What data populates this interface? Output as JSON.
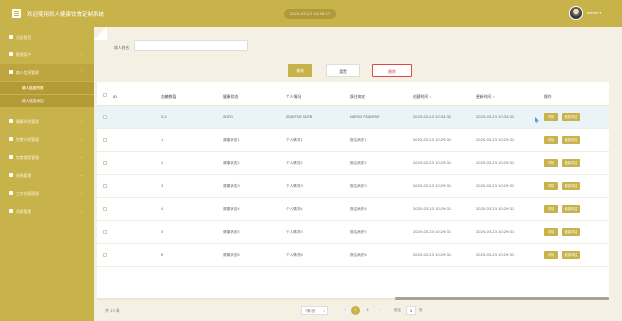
{
  "header": {
    "title": "欢迎使用凯人健康饮食定制系统",
    "datetime": "2025-03-23 10:36:17",
    "user": "admin"
  },
  "sidebar": {
    "items": [
      {
        "label": "功员首页",
        "icon": "home-icon",
        "expandable": false
      },
      {
        "label": "影视用户",
        "icon": "user-icon",
        "expandable": true
      },
      {
        "label": "病人信息管理",
        "icon": "grid-icon",
        "expandable": true,
        "active": true
      },
      {
        "label": "健康评估管理",
        "icon": "grid-icon",
        "expandable": true
      },
      {
        "label": "饮食分类管理",
        "icon": "grid-icon",
        "expandable": true
      },
      {
        "label": "饮食搜索管理",
        "icon": "grid-icon",
        "expandable": true
      },
      {
        "label": "系统管理",
        "icon": "gear-icon",
        "expandable": true
      },
      {
        "label": "工作台管理理",
        "icon": "grid-icon",
        "expandable": true
      },
      {
        "label": "消息管理",
        "icon": "gear-icon",
        "expandable": true
      }
    ],
    "subitems": [
      {
        "label": "病人信息列表",
        "current": true
      },
      {
        "label": "病人信息添加",
        "current": false
      }
    ]
  },
  "search": {
    "label": "病人姓名",
    "value": "",
    "placeholder": ""
  },
  "toolbar": {
    "search_label": "查询",
    "reset_label": "重置",
    "delete_label": "删除"
  },
  "table": {
    "columns": [
      "ID",
      "血糖数值",
      "健康状态",
      "个人情况",
      "既往病史",
      "创建时间",
      "更新时间",
      "操作"
    ],
    "rows": [
      {
        "id": "",
        "sugar": "5.2",
        "status": "SDFD",
        "personal": "SDJKFSD SDFB",
        "history": "NKFSD FSDNFKE",
        "created": "2025-03-23 10:34:32",
        "updated": "2025-03-23 10:34:32"
      },
      {
        "id": "",
        "sugar": "1",
        "status": "健康状态1",
        "personal": "个人情况1",
        "history": "既往病史1",
        "created": "2025-03-23 10:29:31",
        "updated": "2025-03-23 10:29:31"
      },
      {
        "id": "",
        "sugar": "2",
        "status": "健康状态2",
        "personal": "个人情况2",
        "history": "既往病史2",
        "created": "2025-03-23 10:29:31",
        "updated": "2025-03-23 10:29:31"
      },
      {
        "id": "",
        "sugar": "3",
        "status": "健康状态3",
        "personal": "个人情况3",
        "history": "既往病史3",
        "created": "2025-03-23 10:29:31",
        "updated": "2025-03-23 10:29:31"
      },
      {
        "id": "",
        "sugar": "4",
        "status": "健康状态4",
        "personal": "个人情况4",
        "history": "既往病史4",
        "created": "2025-03-23 10:29:31",
        "updated": "2025-03-23 10:29:31"
      },
      {
        "id": "",
        "sugar": "5",
        "status": "健康状态5",
        "personal": "个人情况5",
        "history": "既往病史5",
        "created": "2025-03-23 10:29:31",
        "updated": "2025-03-23 10:29:31"
      },
      {
        "id": "",
        "sugar": "6",
        "status": "健康状态6",
        "personal": "个人情况6",
        "history": "既往病史6",
        "created": "2025-03-23 10:29:31",
        "updated": "2025-03-23 10:29:31"
      }
    ],
    "actions": {
      "detail": "详情",
      "evaluate": "健康评估"
    }
  },
  "pagination": {
    "total": "共 13 条",
    "page_size": "7条/页",
    "pages": [
      "1",
      "2"
    ],
    "current_page": "1",
    "goto_label": "前往",
    "goto_value": "1",
    "goto_unit": "页"
  },
  "colors": {
    "accent": "#c8b24a",
    "sidebar_bg": "#c8b24a",
    "danger": "#d94b4b",
    "highlight_row": "#eaf3f6"
  }
}
